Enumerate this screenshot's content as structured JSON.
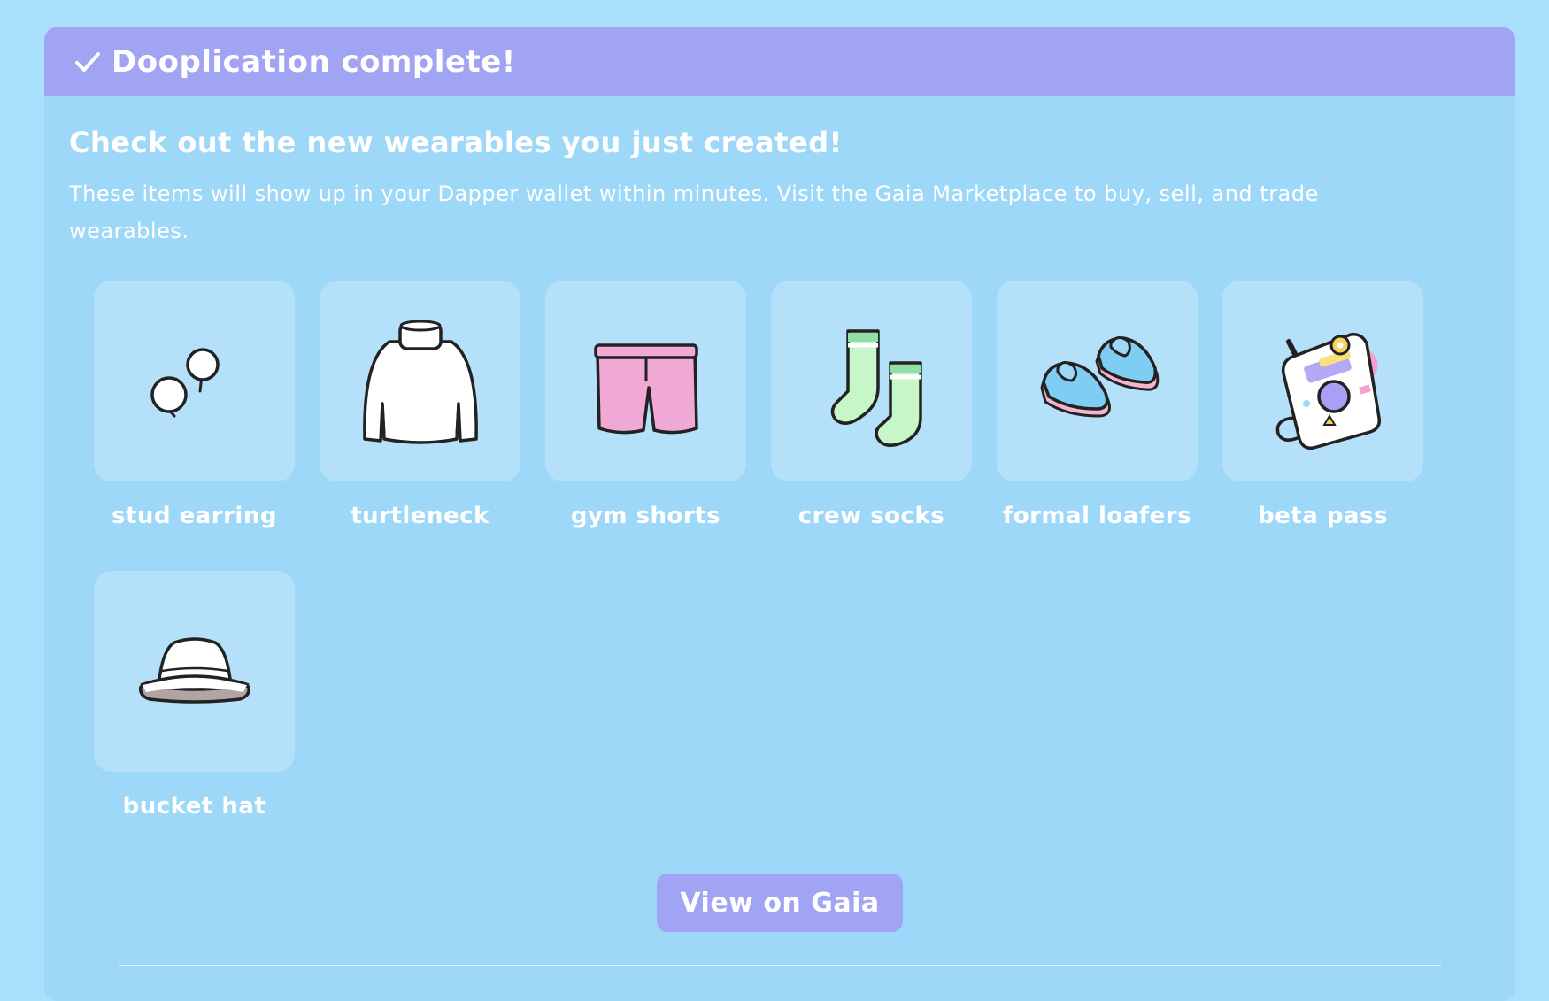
{
  "banner": {
    "title": "Dooplication complete!",
    "icon": "check-icon"
  },
  "main": {
    "heading": "Check out the new wearables you just created!",
    "description": "These items will show up in your Dapper wallet within minutes. Visit the Gaia Marketplace to buy, sell, and trade wearables."
  },
  "items": [
    {
      "label": "stud earring",
      "icon": "stud-earring-icon"
    },
    {
      "label": "turtleneck",
      "icon": "turtleneck-icon"
    },
    {
      "label": "gym shorts",
      "icon": "gym-shorts-icon"
    },
    {
      "label": "crew socks",
      "icon": "crew-socks-icon"
    },
    {
      "label": "formal loafers",
      "icon": "formal-loafers-icon"
    },
    {
      "label": "beta pass",
      "icon": "beta-pass-icon"
    },
    {
      "label": "bucket hat",
      "icon": "bucket-hat-icon"
    }
  ],
  "actions": {
    "view_label": "View on Gaia"
  },
  "colors": {
    "background": "#a9dffb",
    "panel": "#9ed8f8",
    "banner": "#a1a3f3",
    "tile": "#b5e0f9",
    "text": "#ffffff"
  }
}
